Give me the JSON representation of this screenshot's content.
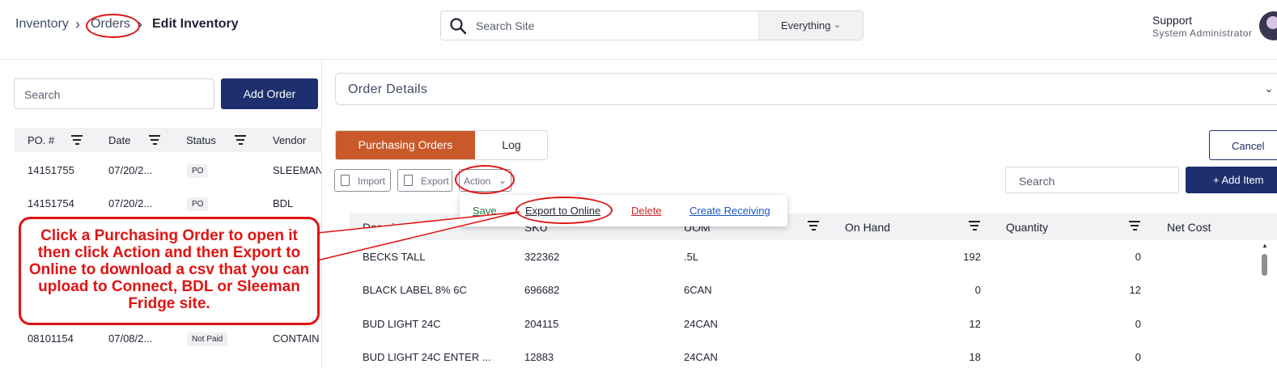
{
  "breadcrumb": {
    "items": [
      "Inventory",
      "Orders"
    ],
    "current": "Edit Inventory"
  },
  "search": {
    "placeholder": "Search Site",
    "scope": "Everything"
  },
  "user": {
    "name": "Support",
    "role": "System Administrator"
  },
  "left": {
    "search_placeholder": "Search",
    "add_order_label": "Add Order",
    "columns": [
      "PO. #",
      "Date",
      "Status",
      "Vendor"
    ],
    "rows": [
      {
        "po": "14151755",
        "date": "07/20/2...",
        "status": "PO",
        "vendor": "SLEEMAN"
      },
      {
        "po": "14151754",
        "date": "07/20/2...",
        "status": "PO",
        "vendor": "BDL"
      },
      {
        "po": "08101154",
        "date": "07/08/2...",
        "status": "Not Paid",
        "vendor": "CONTAIN"
      }
    ]
  },
  "order_details": {
    "title": "Order Details"
  },
  "tabs": [
    "Purchasing Orders",
    "Log"
  ],
  "buttons": {
    "cancel": "Cancel",
    "import": "Import",
    "export": "Export",
    "action": "Action",
    "add_item": "+ Add Item"
  },
  "right_search_placeholder": "Search",
  "action_menu": [
    "Save",
    "Export to Online",
    "Delete",
    "Create Receiving"
  ],
  "table": {
    "columns": [
      "Descripti...",
      "SKU",
      "UOM",
      "On Hand",
      "Quantity",
      "Net Cost"
    ],
    "rows": [
      {
        "desc": "BECKS TALL",
        "sku": "322362",
        "uom": ".5L",
        "on_hand": "192",
        "qty": "0"
      },
      {
        "desc": "BLACK LABEL 8% 6C",
        "sku": "696682",
        "uom": "6CAN",
        "on_hand": "0",
        "qty": "12"
      },
      {
        "desc": "BUD LIGHT 24C",
        "sku": "204115",
        "uom": "24CAN",
        "on_hand": "12",
        "qty": "0"
      },
      {
        "desc": "BUD LIGHT 24C ENTER ...",
        "sku": "12883",
        "uom": "24CAN",
        "on_hand": "18",
        "qty": "0"
      }
    ]
  },
  "callout": {
    "text": "Click a Purchasing Order to open it then click Action and then Export to Online to download a csv that you can upload to Connect, BDL or Sleeman Fridge site."
  },
  "colors": {
    "primary": "#1d2f6e",
    "tab_active": "#c9592a",
    "annotation": "#e01414",
    "save": "#1e7a3c",
    "delete": "#c62828",
    "link": "#1a56c4"
  }
}
